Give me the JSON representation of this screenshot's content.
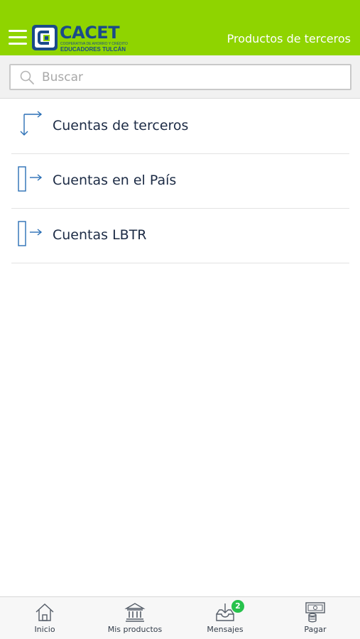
{
  "header": {
    "brand_name": "CACET",
    "brand_tagline": "COOPERATIVA DE AHORRO Y CRÉDITO",
    "brand_subtitle": "EDUCADORES TULCÁN",
    "title": "Productos de terceros",
    "menu_icon": "hamburger-menu-icon"
  },
  "search": {
    "placeholder": "Buscar",
    "value": "",
    "icon": "search-icon"
  },
  "list": {
    "items": [
      {
        "label": "Cuentas de terceros",
        "icon": "transfer-arrows-icon"
      },
      {
        "label": "Cuentas en el País",
        "icon": "account-transfer-icon"
      },
      {
        "label": "Cuentas LBTR",
        "icon": "account-transfer-icon"
      }
    ]
  },
  "tabbar": {
    "tabs": [
      {
        "label": "Inicio",
        "icon": "home-icon"
      },
      {
        "label": "Mis productos",
        "icon": "bank-icon"
      },
      {
        "label": "Mensajes",
        "icon": "inbox-icon",
        "badge": "2"
      },
      {
        "label": "Pagar",
        "icon": "payment-icon"
      }
    ]
  },
  "colors": {
    "header_bg": "#8fd400",
    "brand_blue": "#1a4a8a",
    "icon_blue": "#2a6fb5",
    "badge_green": "#27c24c"
  }
}
